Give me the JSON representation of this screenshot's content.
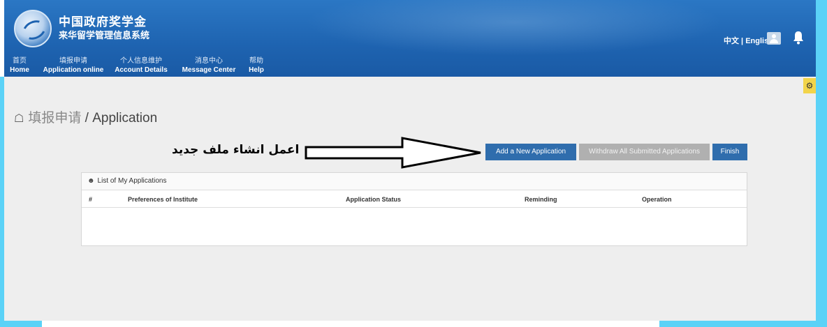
{
  "header": {
    "title_cn": "中国政府奖学金",
    "subtitle_cn": "来华留学管理信息系统",
    "lang_cn": "中文",
    "lang_sep": " | ",
    "lang_en": "English"
  },
  "nav": [
    {
      "cn": "首页",
      "en": "Home"
    },
    {
      "cn": "填报申请",
      "en": "Application online"
    },
    {
      "cn": "个人信息维护",
      "en": "Account Details"
    },
    {
      "cn": "消息中心",
      "en": "Message Center"
    },
    {
      "cn": "帮助",
      "en": "Help"
    }
  ],
  "page": {
    "title_cn": "填报申请",
    "title_sep": " / ",
    "title_en": "Application"
  },
  "annotation": {
    "text": "اعمل انشاء ملف جديد"
  },
  "buttons": {
    "add": "Add a New Application",
    "withdraw": "Withdraw All Submitted Applications",
    "finish": "Finish"
  },
  "panel": {
    "title": "List of My Applications",
    "columns": [
      "#",
      "Preferences of Institute",
      "Application Status",
      "Reminding",
      "Operation"
    ]
  },
  "colors": {
    "header_blue": "#1e63b0",
    "button_blue": "#2f6dad",
    "button_disabled": "#b0b0b0",
    "frame_cyan": "#5bd2f7"
  },
  "icons": [
    "logo-emblem",
    "user-icon",
    "bell-icon",
    "gear-icon",
    "home-icon",
    "users-icon",
    "arrow-right-icon"
  ]
}
